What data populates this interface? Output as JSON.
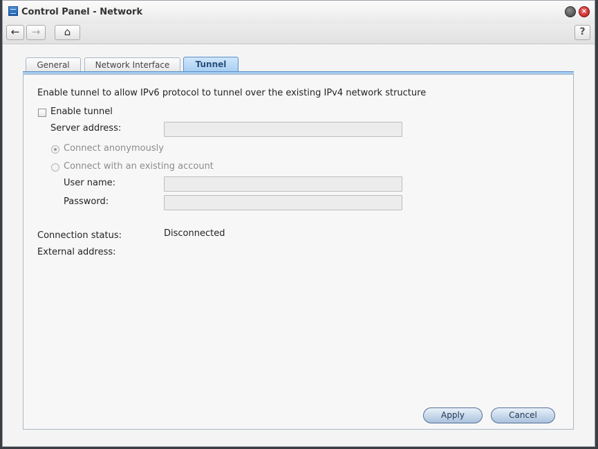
{
  "window": {
    "title": "Control Panel - Network",
    "min_glyph": "•",
    "close_glyph": "×"
  },
  "toolbar": {
    "back_icon": "←",
    "forward_icon": "→",
    "home_icon": "⌂",
    "help_label": "?"
  },
  "tabs": [
    {
      "label": "General"
    },
    {
      "label": "Network Interface"
    },
    {
      "label": "Tunnel",
      "active": true
    }
  ],
  "tunnel": {
    "description": "Enable tunnel to allow IPv6 protocol to tunnel over the existing IPv4 network structure",
    "enable_label": "Enable tunnel",
    "enable_checked": false,
    "server_address_label": "Server address:",
    "server_address_value": "",
    "radio_anonymous_label": "Connect anonymously",
    "radio_account_label": "Connect with an existing account",
    "selected_mode": "anonymous",
    "username_label": "User name:",
    "username_value": "",
    "password_label": "Password:",
    "password_value": "",
    "status_label": "Connection status:",
    "status_value": "Disconnected",
    "external_label": "External address:",
    "external_value": ""
  },
  "buttons": {
    "apply": "Apply",
    "cancel": "Cancel"
  },
  "colors": {
    "active_tab": "#a6cdf1",
    "button": "#aac2dd",
    "close": "#b71515"
  }
}
